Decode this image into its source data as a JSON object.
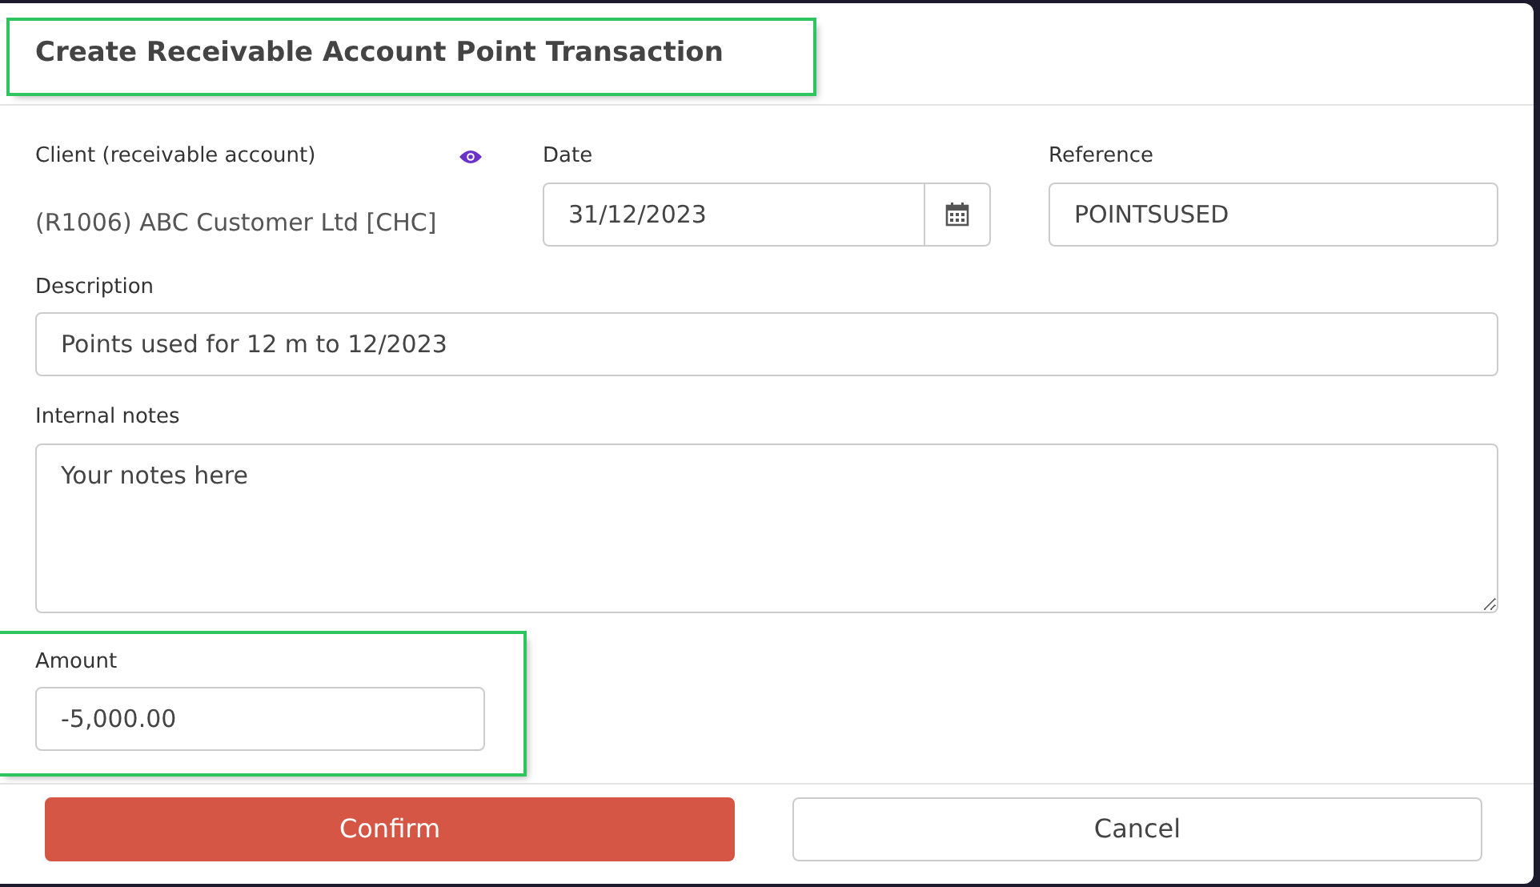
{
  "dialog": {
    "title": "Create Receivable Account Point Transaction",
    "title_highlighted": true
  },
  "client": {
    "label": "Client (receivable account)",
    "value": "(R1006) ABC Customer Ltd [CHC]"
  },
  "date": {
    "label": "Date",
    "value": "31/12/2023"
  },
  "reference": {
    "label": "Reference",
    "value": "POINTSUSED"
  },
  "description": {
    "label": "Description",
    "value": "Points used for 12 m to 12/2023"
  },
  "internal_notes": {
    "label": "Internal notes",
    "placeholder": "Your notes here"
  },
  "amount": {
    "label": "Amount",
    "value": "-5,000.00",
    "highlighted": true
  },
  "buttons": [
    {
      "label": "Confirm",
      "kind": "primary"
    },
    {
      "label": "Cancel",
      "kind": "secondary"
    }
  ]
}
